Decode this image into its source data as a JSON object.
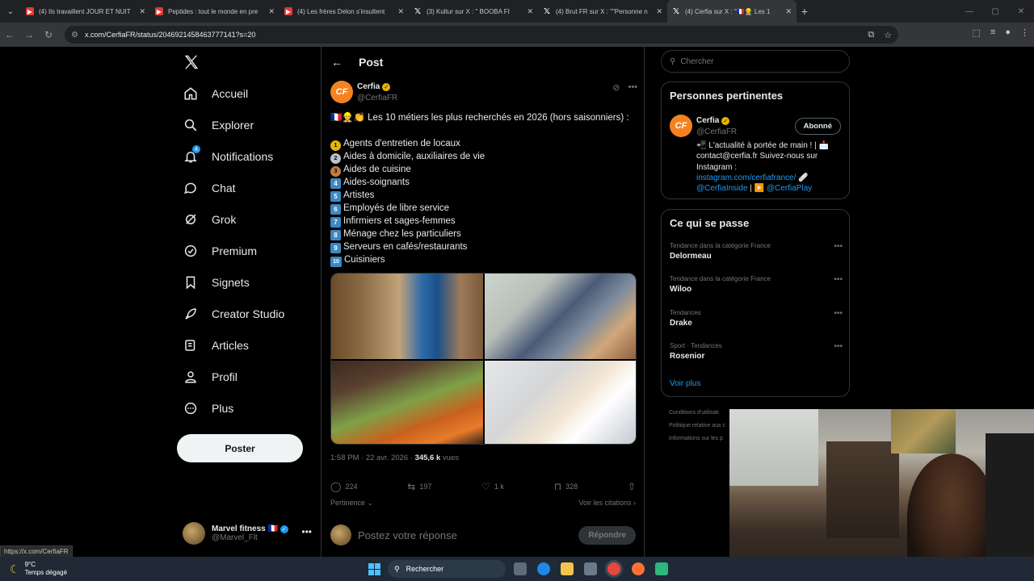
{
  "browser": {
    "tabs": [
      {
        "title": "(4) Ils travaillent JOUR ET NUIT",
        "type": "yt",
        "active": false
      },
      {
        "title": "Peptides : tout le monde en pre",
        "type": "yt",
        "active": false
      },
      {
        "title": "(4) Les frères Delon s'insultent",
        "type": "yt",
        "active": false
      },
      {
        "title": "(3) Kultur sur X : \" BOOBA FI",
        "type": "x",
        "active": false
      },
      {
        "title": "(4) Brut FR sur X : \"\"Personne n",
        "type": "x",
        "active": false
      },
      {
        "title": "(4) Cerfia sur X : \"🇫🇷👷 Les 1",
        "type": "x",
        "active": true
      }
    ],
    "url": "x.com/CerfiaFR/status/2046921458463777141?s=20",
    "status_url": "https://x.com/CerfiaFR"
  },
  "nav": {
    "items": [
      {
        "label": "Accueil",
        "icon": "home-icon"
      },
      {
        "label": "Explorer",
        "icon": "search-icon"
      },
      {
        "label": "Notifications",
        "icon": "bell-icon",
        "badge": "4"
      },
      {
        "label": "Chat",
        "icon": "chat-icon"
      },
      {
        "label": "Grok",
        "icon": "grok-icon"
      },
      {
        "label": "Premium",
        "icon": "premium-icon"
      },
      {
        "label": "Signets",
        "icon": "bookmark-icon"
      },
      {
        "label": "Creator Studio",
        "icon": "rocket-icon"
      },
      {
        "label": "Articles",
        "icon": "article-icon"
      },
      {
        "label": "Profil",
        "icon": "person-icon"
      },
      {
        "label": "Plus",
        "icon": "more-circle-icon"
      }
    ],
    "post_button": "Poster",
    "account": {
      "name": "Marvel fitness 🇫🇷",
      "handle": "@Marvel_Flt"
    }
  },
  "post": {
    "header": "Post",
    "author": {
      "name": "Cerfia",
      "handle": "@CerfiaFR",
      "avatar_text": "CF"
    },
    "intro": "🇫🇷👷‍♂️👏 Les 10 métiers les plus recherchés en 2026 (hors saisonniers) :",
    "jobs": [
      {
        "marker": "gold",
        "label": "Agents d'entretien de locaux"
      },
      {
        "marker": "silver",
        "label": "Aides à domicile, auxiliaires de vie"
      },
      {
        "marker": "bronze",
        "label": "Aides de cuisine"
      },
      {
        "marker": "4",
        "label": "Aides-soignants"
      },
      {
        "marker": "5",
        "label": "Artistes"
      },
      {
        "marker": "6",
        "label": "Employés de libre service"
      },
      {
        "marker": "7",
        "label": "Infirmiers et sages-femmes"
      },
      {
        "marker": "8",
        "label": "Ménage chez les particuliers"
      },
      {
        "marker": "9",
        "label": "Serveurs en cafés/restaurants"
      },
      {
        "marker": "10",
        "label": "Cuisiniers"
      }
    ],
    "time": "1:58 PM · 22 avr. 2026 · ",
    "views": "345,6 k",
    "views_label": " vues",
    "stats": {
      "replies": "224",
      "reposts": "197",
      "likes": "1 k",
      "bookmarks": "328"
    },
    "sort_label": "Pertinence",
    "quotes_label": "Voir les citations",
    "reply_placeholder": "Postez votre réponse",
    "reply_button": "Répondre"
  },
  "sidebar": {
    "search_placeholder": "Chercher",
    "relevant": {
      "title": "Personnes pertinentes",
      "name": "Cerfia",
      "handle": "@CerfiaFR",
      "follow": "Abonné",
      "bio_line1": "📲 L'actualité à portée de main ! | 📩",
      "bio_line2": "contact@cerfia.fr Suivez-nous sur",
      "bio_line3": "Instagram :",
      "bio_link1": "instagram.com/cerfiafrance/",
      "bio_link1_suffix": " 🩹",
      "bio_link2": "@CerfiaInside",
      "bio_sep": " | ▶️ ",
      "bio_link3": "@CerfiaPlay"
    },
    "trending": {
      "title": "Ce qui se passe",
      "items": [
        {
          "context": "Tendance dans la catégorie France",
          "name": "Delormeau"
        },
        {
          "context": "Tendance dans la catégorie France",
          "name": "Wiloo"
        },
        {
          "context": "Tendances",
          "name": "Drake"
        },
        {
          "context": "Sport · Tendances",
          "name": "Rosenior"
        }
      ],
      "more": "Voir plus"
    },
    "footer": [
      "Conditions d'utilisati",
      "Politique relative aux c",
      "Informations sur les p"
    ]
  },
  "taskbar": {
    "temp": "9°C",
    "weather": "Temps dégagé",
    "search": "Rechercher"
  },
  "colors": {
    "accent": "#1d9bf0",
    "cerfia_orange": "#f58220",
    "bg": "#000000"
  }
}
